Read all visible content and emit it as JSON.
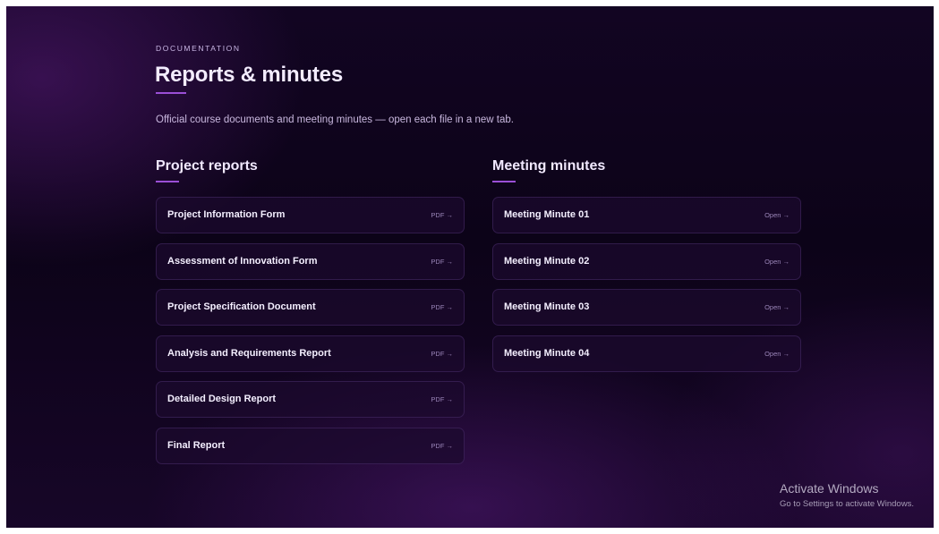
{
  "header": {
    "eyebrow": "DOCUMENTATION",
    "title": "Reports & minutes",
    "subtitle": "Official course documents and meeting minutes — open each file in a new tab."
  },
  "project_reports": {
    "title": "Project reports",
    "items": [
      {
        "label": "Project Information Form",
        "action": "PDF →"
      },
      {
        "label": "Assessment of Innovation Form",
        "action": "PDF →"
      },
      {
        "label": "Project Specification Document",
        "action": "PDF →"
      },
      {
        "label": "Analysis and Requirements Report",
        "action": "PDF →"
      },
      {
        "label": "Detailed Design Report",
        "action": "PDF →"
      },
      {
        "label": "Final Report",
        "action": "PDF →"
      }
    ]
  },
  "meeting_minutes": {
    "title": "Meeting minutes",
    "items": [
      {
        "label": "Meeting Minute 01",
        "action": "Open →"
      },
      {
        "label": "Meeting Minute 02",
        "action": "Open →"
      },
      {
        "label": "Meeting Minute 03",
        "action": "Open →"
      },
      {
        "label": "Meeting Minute 04",
        "action": "Open →"
      }
    ]
  },
  "watermark": {
    "title": "Activate Windows",
    "subtitle": "Go to Settings to activate Windows."
  },
  "colors": {
    "accent": "#9b4fd6",
    "background": "#0c0318",
    "card": "#1c0a2e"
  }
}
